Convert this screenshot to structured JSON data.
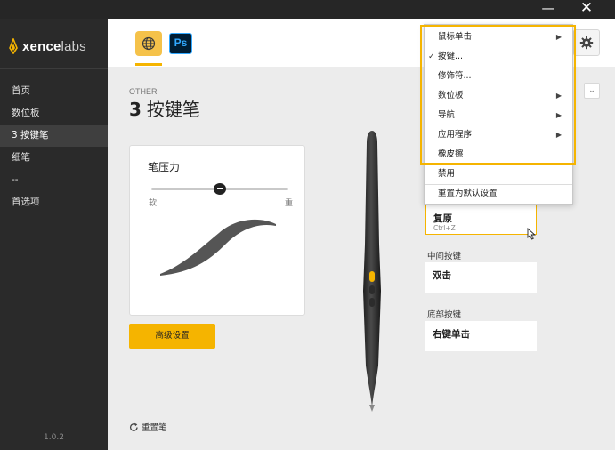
{
  "titlebar": {
    "minimize_glyph": "—",
    "close_glyph": "✕"
  },
  "sidebar": {
    "logo": {
      "bold": "xence",
      "rest": "labs"
    },
    "items": [
      {
        "label": "首页"
      },
      {
        "label": "数位板"
      },
      {
        "label": "3 按键笔"
      },
      {
        "label": "细笔"
      },
      {
        "label": "--"
      },
      {
        "label": "首选项"
      }
    ],
    "active_index": 2,
    "version": "1.0.2"
  },
  "apps": {
    "tabs": [
      {
        "name": "global-app",
        "icon": "globe-icon"
      },
      {
        "name": "photoshop-app",
        "icon": "ps-icon",
        "label": "Ps"
      }
    ],
    "selected": "global-app"
  },
  "page": {
    "crumb": "OTHER",
    "title_number": "3",
    "title_text": "按键笔"
  },
  "pressure": {
    "title": "笔压力",
    "min_label": "软",
    "max_label": "重",
    "slider_value": 0.5
  },
  "advanced_button": "高级设置",
  "reset_pen": "重置笔",
  "pen_select": {
    "arrow": "⌄"
  },
  "buttons": {
    "upper": {
      "value": "复原",
      "shortcut": "Ctrl+Z"
    },
    "middle": {
      "label": "中间按键",
      "value": "双击"
    },
    "lower": {
      "label": "底部按键",
      "value": "右键单击"
    }
  },
  "menu": {
    "items": [
      {
        "label": "鼠标单击",
        "submenu": true,
        "checked": false
      },
      {
        "label": "按键...",
        "submenu": false,
        "checked": true
      },
      {
        "label": "修饰符...",
        "submenu": false,
        "checked": false
      },
      {
        "label": "数位板",
        "submenu": true,
        "checked": false
      },
      {
        "label": "导航",
        "submenu": true,
        "checked": false
      },
      {
        "label": "应用程序",
        "submenu": true,
        "checked": false
      },
      {
        "label": "橡皮擦",
        "submenu": false,
        "checked": false
      },
      {
        "label": "禁用",
        "submenu": false,
        "checked": false
      },
      {
        "label": "重置为默认设置",
        "submenu": false,
        "checked": false
      }
    ],
    "check_glyph": "✓",
    "chevron_glyph": "▶"
  },
  "colors": {
    "accent": "#f5b400",
    "sidebar_bg": "#2a2a2a",
    "titlebar_bg": "#262626",
    "curve": "#555555"
  }
}
